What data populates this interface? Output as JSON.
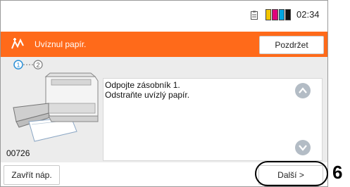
{
  "status": {
    "time": "02:34",
    "icons": [
      "clipboard-icon",
      "toner-levels-icon"
    ],
    "toner_colors": [
      "#f2c500",
      "#e0007a",
      "#00a6e0",
      "#111111"
    ]
  },
  "header": {
    "title": "Uvíznul papír.",
    "hold_label": "Pozdržet",
    "icon": "paper-jam-icon",
    "accent": "#ff6a1a"
  },
  "steps": {
    "current": "1",
    "total": "2"
  },
  "message": {
    "lines": [
      "Odpojte zásobník 1.",
      "Odstraňte uvízlý papír."
    ]
  },
  "error_code": "00726",
  "footer": {
    "close_label": "Zavřít náp.",
    "next_label": "Další >"
  },
  "callout": {
    "number": "6"
  }
}
